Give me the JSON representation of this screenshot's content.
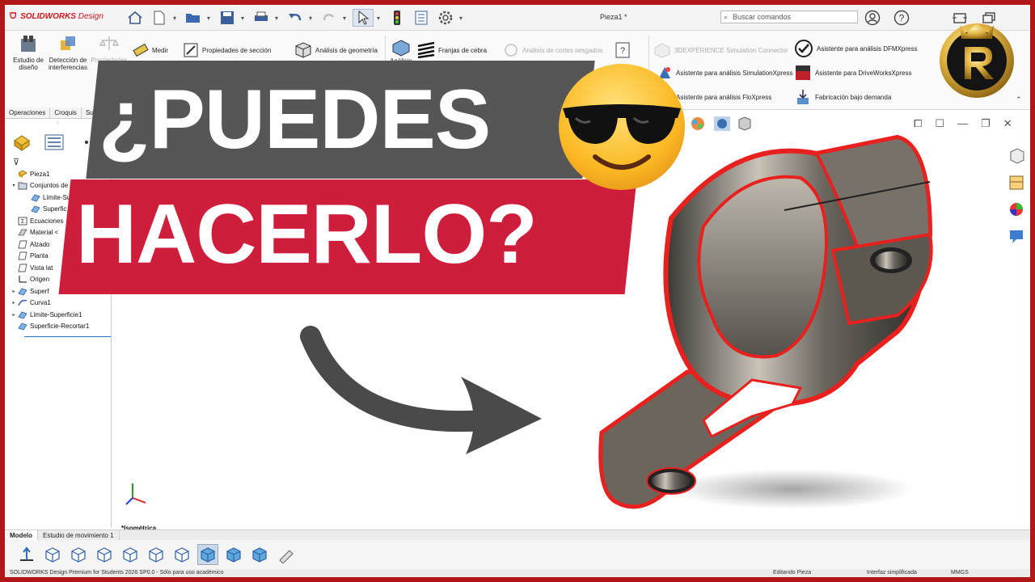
{
  "app": {
    "brand": "SOLIDWORKS",
    "brand_suffix": "Design",
    "document_title": "Pieza1 *",
    "search_placeholder": "Buscar comandos"
  },
  "command_manager": {
    "big_buttons": [
      "Estudio de diseño",
      "Detección de interferencias",
      "Propiedades físicas"
    ],
    "items": [
      {
        "label": "Medir",
        "enabled": true
      },
      {
        "label": "Propiedades de sección",
        "enabled": true
      },
      {
        "label": "Análisis de geometría",
        "enabled": true
      },
      {
        "label": "Análisis",
        "enabled": true
      },
      {
        "label": "Franjas de cebra",
        "enabled": true
      },
      {
        "label": "Análisis de cortes sesgados",
        "enabled": false
      },
      {
        "label": "3DEXPERIENCE Simulation Connector",
        "enabled": false
      },
      {
        "label": "Asistente para análisis SimulationXpress",
        "enabled": true
      },
      {
        "label": "Asistente para análisis FloXpress",
        "enabled": true
      },
      {
        "label": "Asistente para análisis DFMXpress",
        "enabled": true
      },
      {
        "label": "Asistente para DriveWorksXpress",
        "enabled": true
      },
      {
        "label": "Fabricación bajo demanda",
        "enabled": true
      }
    ]
  },
  "left_panel": {
    "tabs": [
      "Operaciones",
      "Croquis",
      "Su"
    ],
    "tree": [
      {
        "label": "Pieza1",
        "expand": "",
        "indent": 0
      },
      {
        "label": "Conjuntos de s",
        "expand": "▾",
        "indent": 0
      },
      {
        "label": "Límite-Su",
        "expand": "",
        "indent": 1
      },
      {
        "label": "Superfic",
        "expand": "",
        "indent": 1
      },
      {
        "label": "Ecuaciones",
        "expand": "",
        "indent": 0
      },
      {
        "label": "Material <",
        "expand": "",
        "indent": 0
      },
      {
        "label": "Alzado",
        "expand": "",
        "indent": 0
      },
      {
        "label": "Planta",
        "expand": "",
        "indent": 0
      },
      {
        "label": "Vista lat",
        "expand": "",
        "indent": 0
      },
      {
        "label": "Origen",
        "expand": "",
        "indent": 0
      },
      {
        "label": "Superf",
        "expand": "▸",
        "indent": 0
      },
      {
        "label": "Curva1",
        "expand": "▸",
        "indent": 0
      },
      {
        "label": "Límite-Superficie1",
        "expand": "▸",
        "indent": 0
      },
      {
        "label": "Superficie-Recortar1",
        "expand": "",
        "indent": 0
      }
    ]
  },
  "viewport": {
    "view_label": "*Isométrica"
  },
  "bottom_tabs": [
    "Modelo",
    "Estudio de movimiento 1"
  ],
  "status_bar": {
    "product": "SOLIDWORKS Design Premium for Students 2026 SP0.0 - Sólo para uso académico",
    "mode": "Editando Pieza",
    "interface": "Interfaz simplificada",
    "units": "MMGS"
  },
  "thumbnail": {
    "headline_line1": "¿PUEDES",
    "headline_line2": "HACERLO?",
    "emoji": "smiling-face-with-sunglasses",
    "colors": {
      "banner_dark": "#565656",
      "banner_red": "#cf1e3b",
      "frame_red": "#b01818",
      "edge_highlight": "#e8201e"
    }
  }
}
